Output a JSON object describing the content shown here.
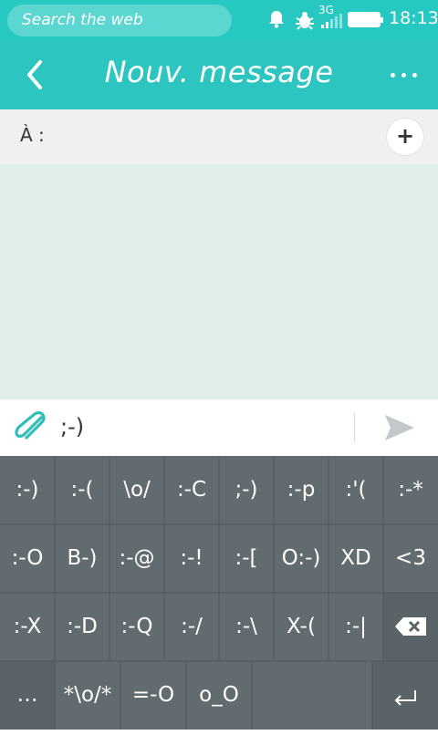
{
  "statusbar": {
    "search_placeholder": "Search the web",
    "network_label": "3G",
    "time": "18:13",
    "icons": [
      "notification-bell-icon",
      "bug-icon",
      "signal-icon",
      "battery-icon"
    ]
  },
  "header": {
    "title": "Nouv. message",
    "back_icon": "chevron-left-icon",
    "more_icon": "ellipsis-icon"
  },
  "recipient": {
    "label": "À :",
    "add_label": "+"
  },
  "compose": {
    "text": ";-)",
    "attach_icon": "paperclip-icon",
    "send_icon": "send-icon"
  },
  "keyboard": {
    "row1": [
      ":-)",
      ":-(",
      "\\o/",
      ":-C",
      ";-)",
      ":-p",
      ":'(",
      ":-*"
    ],
    "row2": [
      ":-O",
      "B-)",
      ":-@",
      ":-!",
      ":-[",
      "O:-)",
      "XD",
      "<3"
    ],
    "row3": [
      ":-X",
      ":-D",
      ":-Q",
      ":-/",
      ":-\\",
      "X-(",
      ":-|"
    ],
    "row4": [
      "…",
      "*\\o/*",
      "=-O",
      "o_O"
    ],
    "backspace_icon": "backspace-icon",
    "enter_icon": "enter-icon"
  },
  "colors": {
    "accent": "#2dc5bf",
    "statusbar": "#27c8c2",
    "message_bg": "#e0efec",
    "keyboard_bg": "#616b70"
  }
}
